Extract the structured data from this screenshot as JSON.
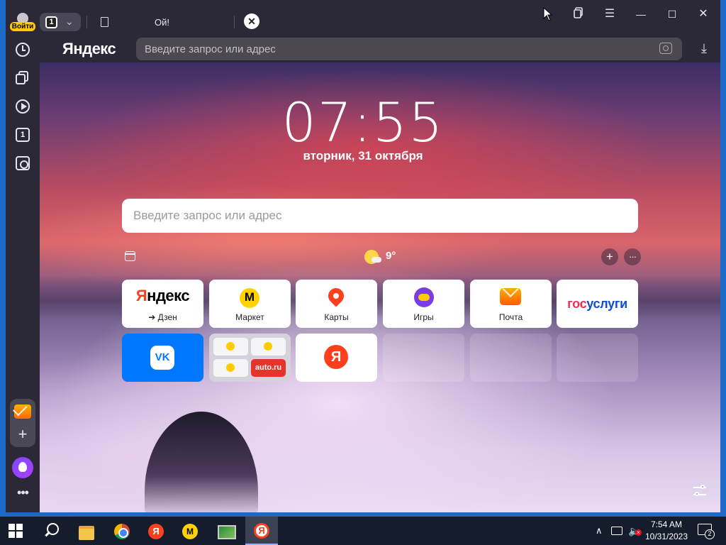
{
  "titlebar": {
    "login_label": "Войти",
    "tab_count": "1",
    "tab_title": "Ой!",
    "close_tab_symbol": "✕"
  },
  "window_controls": {
    "collections_icon": "collections-icon",
    "menu_symbol": "☰",
    "minimize_symbol": "—",
    "maximize_symbol": "☐",
    "close_symbol": "✕"
  },
  "address_bar": {
    "logo": "Яндекс",
    "placeholder": "Введите запрос или адрес",
    "download_symbol": "⤓"
  },
  "sidebar": {
    "counter": "1",
    "add_symbol": "+",
    "more_symbol": "•••"
  },
  "new_tab": {
    "time": "07:55",
    "date": "вторник, 31 октября",
    "search_placeholder": "Введите запрос или адрес",
    "weather_temp": "9°",
    "add_symbol": "+",
    "more_symbol": "···"
  },
  "tiles": {
    "yandex_logo_first": "Я",
    "yandex_logo_rest": "ндекс",
    "yandex_label": "➔ Дзен",
    "market_label": "Маркет",
    "maps_label": "Карты",
    "games_label": "Игры",
    "mail_label": "Почта",
    "gosuslugi_part1": "гос",
    "gosuslugi_part2": "услуги",
    "vk_logo": "VK",
    "autoru_label": "auto.ru",
    "ya_logo": "Я"
  },
  "taskbar": {
    "time": "7:54 AM",
    "date": "10/31/2023",
    "notification_count": "2",
    "tray_chevron": "∧",
    "volume_symbol": "🔈"
  },
  "colors": {
    "yandex_red": "#fc3f1d",
    "vk_blue": "#0077ff",
    "gosuslugi_blue": "#0d4cd3",
    "gosuslugi_red": "#ee2f53",
    "taskbar_bg": "#151d2c"
  }
}
